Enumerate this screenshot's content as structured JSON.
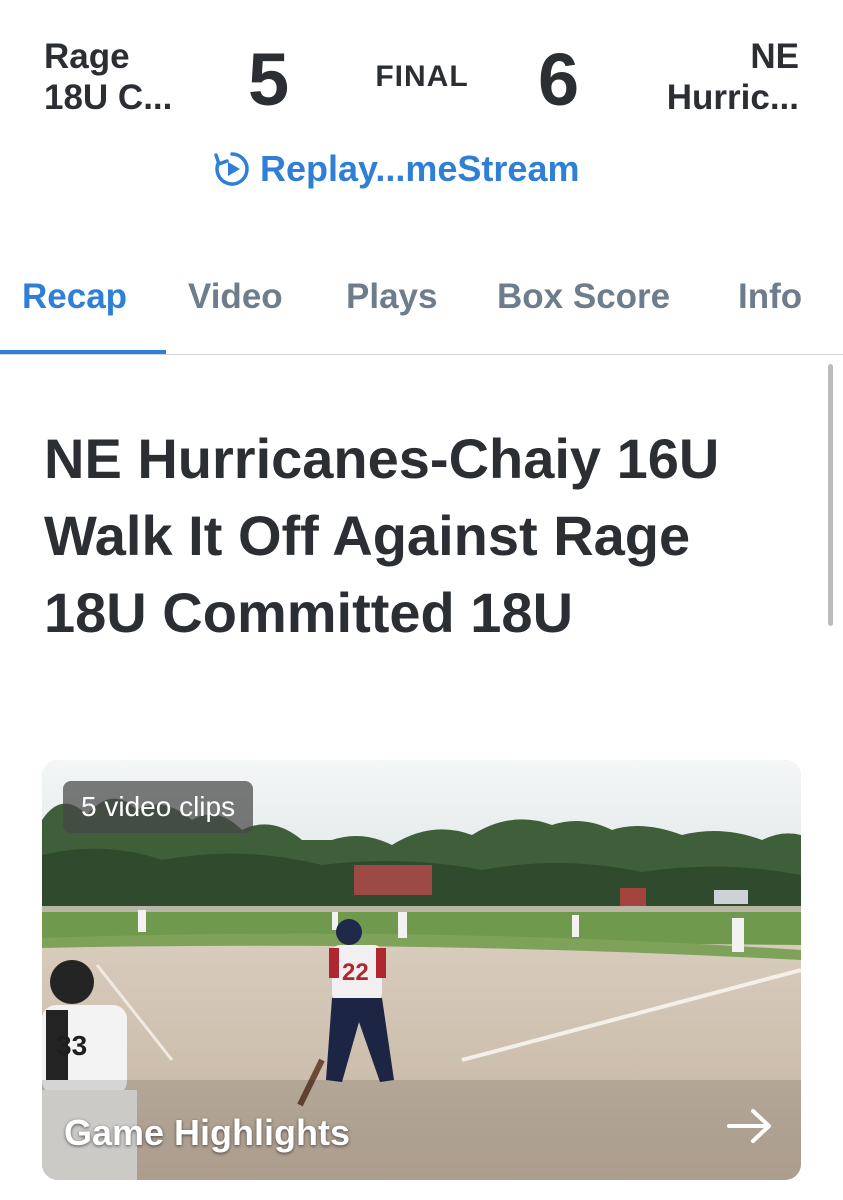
{
  "game": {
    "away_team": {
      "line1": "Rage",
      "line2": "18U C..."
    },
    "home_team": {
      "line1": "NE",
      "line2": "Hurric..."
    },
    "away_score": "5",
    "home_score": "6",
    "status": "FINAL",
    "replay_label": "Replay...meStream"
  },
  "tabs": [
    {
      "label": "Recap",
      "active": true
    },
    {
      "label": "Video",
      "active": false
    },
    {
      "label": "Plays",
      "active": false
    },
    {
      "label": "Box Score",
      "active": false
    },
    {
      "label": "Info",
      "active": false
    }
  ],
  "headline": "NE Hurricanes-Chaiy 16U Walk It Off Against Rage 18U Committed 18U",
  "video_card": {
    "clips_badge": "5 video clips",
    "title": "Game Highlights",
    "icon": "arrow-right-icon"
  },
  "colors": {
    "accent": "#2f7fd6",
    "text": "#2b2e33",
    "tab_inactive": "#6e7d8c",
    "divider": "#d2d5d9"
  }
}
